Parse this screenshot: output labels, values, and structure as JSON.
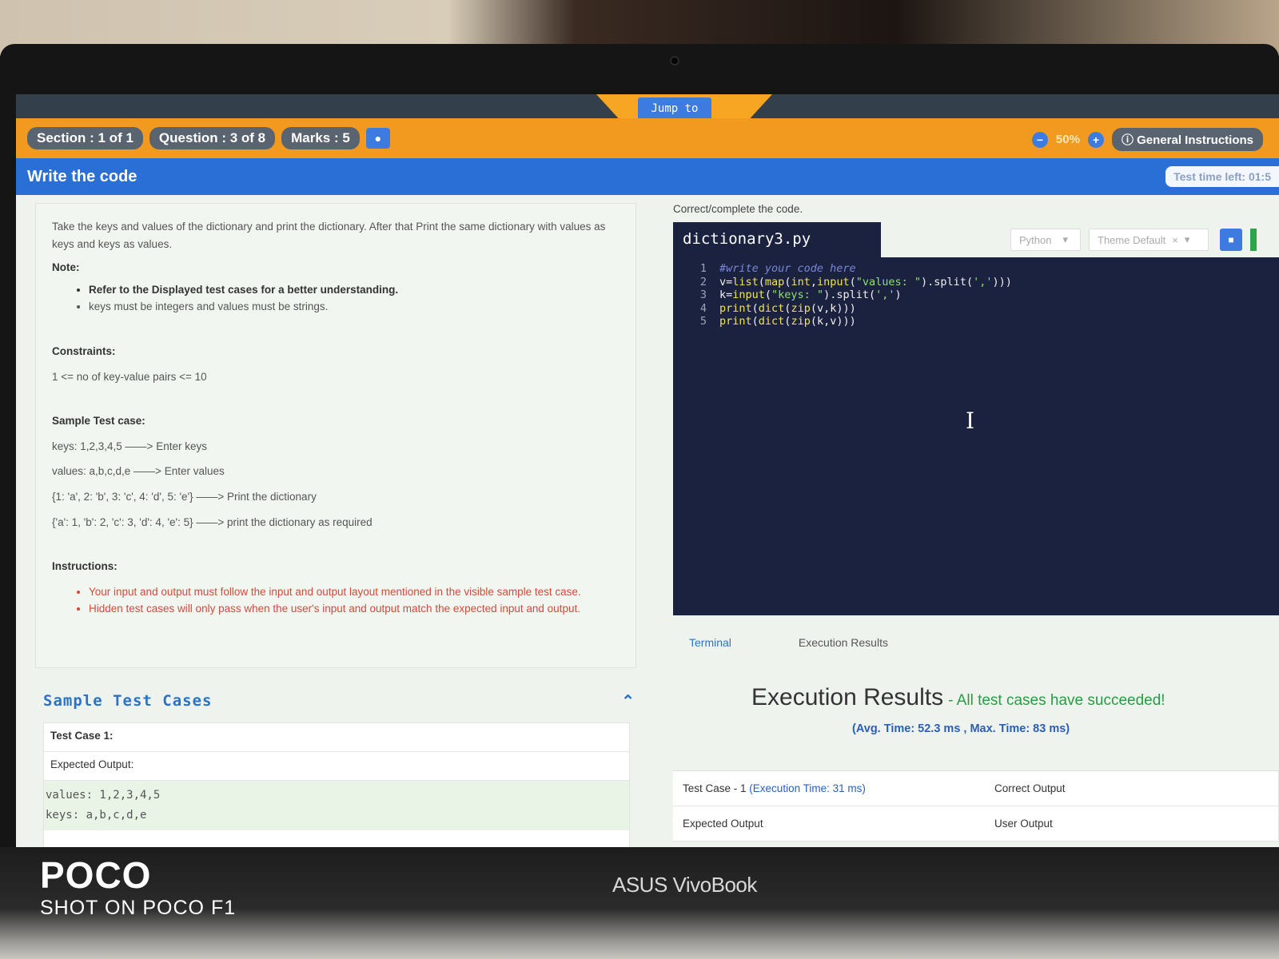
{
  "header": {
    "jump_label": "Jump to",
    "section": "Section : 1 of 1",
    "question": "Question : 3 of 8",
    "marks": "Marks : 5",
    "zoom": "50%",
    "general_instructions": "General Instructions",
    "title": "Write the code",
    "timer": "Test time left: 01:5"
  },
  "question": {
    "description": "Take the keys and values of the dictionary and print the dictionary. After that Print the same dictionary with values as keys and keys as values.",
    "note_label": "Note:",
    "notes": [
      "Refer to the Displayed test cases for a better understanding.",
      "keys must be integers and values must be strings."
    ],
    "constraints_label": "Constraints:",
    "constraint": "1 <= no of key-value pairs <= 10",
    "sample_label": "Sample Test case:",
    "sample_lines": [
      "keys: 1,2,3,4,5 ——> Enter keys",
      "values: a,b,c,d,e ——> Enter values",
      "{1: 'a', 2: 'b', 3: 'c', 4: 'd', 5: 'e'} ——> Print the dictionary",
      "{'a': 1, 'b': 2, 'c': 3, 'd': 4, 'e': 5} ——> print the dictionary as required"
    ],
    "instructions_label": "Instructions:",
    "instructions": [
      "Your input and output must follow the input and output layout mentioned in the visible sample test case.",
      "Hidden test cases will only pass when the user's input and output match the expected input and output."
    ]
  },
  "sample_cases": {
    "title": "Sample Test Cases",
    "test_case_label": "Test Case 1:",
    "expected_label": "Expected Output:",
    "lines": [
      "values: 1,2,3,4,5",
      "keys: a,b,c,d,e"
    ]
  },
  "editor": {
    "instruction": "Correct/complete the code.",
    "filename": "dictionary3.py",
    "language": "Python",
    "theme": "Theme Default",
    "line_numbers": [
      "1",
      "2",
      "3",
      "4",
      "5"
    ]
  },
  "tabs": [
    "Terminal",
    "Execution Results"
  ],
  "results": {
    "title": "Execution Results",
    "status": "- All test cases have succeeded!",
    "avg": "(Avg. Time: 52.3 ms , Max. Time: 83 ms)",
    "test_case": "Test Case - 1",
    "exec_time": "(Execution Time: 31 ms)",
    "correct_output": "Correct Output",
    "expected_output": "Expected Output",
    "user_output": "User Output"
  },
  "branding": {
    "phone_brand": "POCO",
    "phone_sub": "SHOT ON POCO F1",
    "laptop": "ASUS VivoBook"
  }
}
